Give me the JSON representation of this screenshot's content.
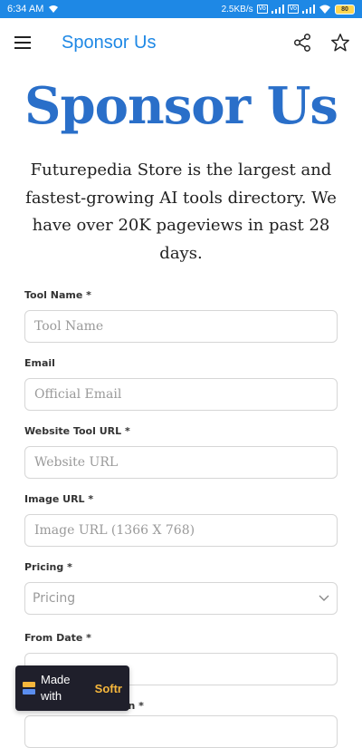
{
  "status_bar": {
    "time": "6:34 AM",
    "net_speed": "2.5KB/s",
    "vo1": "Vo",
    "vo2": "Vo",
    "battery": "80"
  },
  "app_bar": {
    "title": "Sponsor Us",
    "menu_icon": "hamburger-menu-icon",
    "share_icon": "share-icon",
    "favorite_icon": "star-icon"
  },
  "hero": {
    "title": "Sponsor Us",
    "intro": "Futurepedia Store is the largest and fastest-growing AI tools directory. We have over 20K pageviews in past 28 days."
  },
  "form": {
    "fields": [
      {
        "label": "Tool Name *",
        "placeholder": "Tool Name"
      },
      {
        "label": "Email",
        "placeholder": "Official Email"
      },
      {
        "label": "Website Tool URL *",
        "placeholder": "Website URL"
      },
      {
        "label": "Image URL *",
        "placeholder": "Image URL (1366 X 768)"
      },
      {
        "label": "Pricing *",
        "placeholder": "Pricing"
      },
      {
        "label": "From Date *",
        "placeholder": ""
      }
    ],
    "partial_label": "ption *"
  },
  "badge": {
    "made": "Made",
    "with": "with",
    "brand": "Softr"
  },
  "colors": {
    "accent": "#1e88e5",
    "hero": "#2a6fc9",
    "badge_bg": "#1f1f2b",
    "badge_brand": "#f6b73c"
  }
}
